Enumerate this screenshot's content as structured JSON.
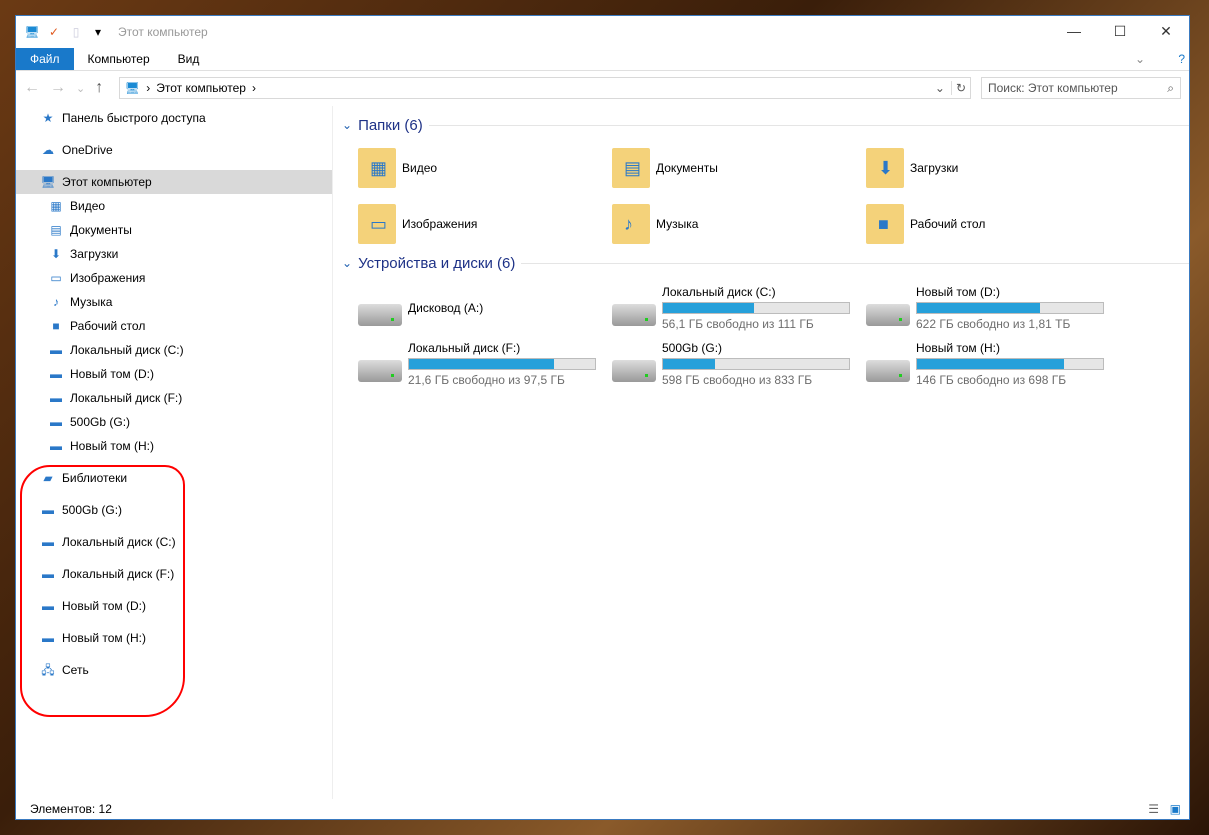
{
  "window": {
    "title": "Этот компьютер",
    "minimize": "—",
    "maximize": "☐",
    "close": "✕"
  },
  "ribbon": {
    "tabs": [
      "Файл",
      "Компьютер",
      "Вид"
    ]
  },
  "nav": {
    "back": "←",
    "forward": "→",
    "recent": "⌄",
    "up": "↑",
    "path": "Этот компьютер",
    "refresh": "↻",
    "search_placeholder": "Поиск: Этот компьютер"
  },
  "sidebar": {
    "items": [
      {
        "label": "Панель быстрого доступа",
        "icon": "★",
        "level": 0
      },
      {
        "label": "OneDrive",
        "icon": "☁",
        "level": 0
      },
      {
        "label": "Этот компьютер",
        "icon": "🖥",
        "level": 0,
        "selected": true
      },
      {
        "label": "Видео",
        "icon": "▦",
        "level": 1
      },
      {
        "label": "Документы",
        "icon": "▤",
        "level": 1
      },
      {
        "label": "Загрузки",
        "icon": "⬇",
        "level": 1
      },
      {
        "label": "Изображения",
        "icon": "▭",
        "level": 1
      },
      {
        "label": "Музыка",
        "icon": "♪",
        "level": 1
      },
      {
        "label": "Рабочий стол",
        "icon": "■",
        "level": 1
      },
      {
        "label": "Локальный диск (C:)",
        "icon": "▬",
        "level": 1
      },
      {
        "label": "Новый том (D:)",
        "icon": "▬",
        "level": 1
      },
      {
        "label": "Локальный диск (F:)",
        "icon": "▬",
        "level": 1
      },
      {
        "label": "500Gb (G:)",
        "icon": "▬",
        "level": 1
      },
      {
        "label": "Новый том (H:)",
        "icon": "▬",
        "level": 1
      },
      {
        "label": "Библиотеки",
        "icon": "▰",
        "level": 0
      },
      {
        "label": "500Gb (G:)",
        "icon": "▬",
        "level": 0
      },
      {
        "label": "Локальный диск (C:)",
        "icon": "▬",
        "level": 0
      },
      {
        "label": "Локальный диск (F:)",
        "icon": "▬",
        "level": 0
      },
      {
        "label": "Новый том (D:)",
        "icon": "▬",
        "level": 0
      },
      {
        "label": "Новый том (H:)",
        "icon": "▬",
        "level": 0
      },
      {
        "label": "Сеть",
        "icon": "🖧",
        "level": 0
      }
    ]
  },
  "folders": {
    "title": "Папки (6)",
    "items": [
      {
        "label": "Видео",
        "glyph": "▦"
      },
      {
        "label": "Документы",
        "glyph": "▤"
      },
      {
        "label": "Загрузки",
        "glyph": "⬇"
      },
      {
        "label": "Изображения",
        "glyph": "▭"
      },
      {
        "label": "Музыка",
        "glyph": "♪"
      },
      {
        "label": "Рабочий стол",
        "glyph": "■"
      }
    ]
  },
  "devices": {
    "title": "Устройства и диски (6)",
    "items": [
      {
        "label": "Дисковод (A:)"
      },
      {
        "label": "Локальный диск (C:)",
        "used_fraction": 0.49,
        "info": "56,1 ГБ свободно из 111 ГБ"
      },
      {
        "label": "Новый том (D:)",
        "used_fraction": 0.66,
        "info": "622 ГБ свободно из 1,81 ТБ"
      },
      {
        "label": "Локальный диск (F:)",
        "used_fraction": 0.78,
        "info": "21,6 ГБ свободно из 97,5 ГБ"
      },
      {
        "label": "500Gb (G:)",
        "used_fraction": 0.28,
        "info": "598 ГБ свободно из 833 ГБ"
      },
      {
        "label": "Новый том (H:)",
        "used_fraction": 0.79,
        "info": "146 ГБ свободно из 698 ГБ"
      }
    ]
  },
  "status": {
    "count": "Элементов: 12"
  }
}
